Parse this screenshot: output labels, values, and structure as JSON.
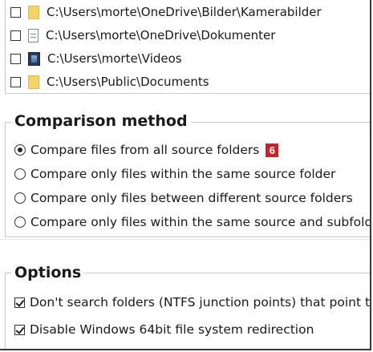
{
  "folders": [
    {
      "path": "C:\\Users\\morte\\OneDrive\\Bilder\\Kamerabilder",
      "checked": false,
      "icon": "folder-icon"
    },
    {
      "path": "C:\\Users\\morte\\OneDrive\\Dokumenter",
      "checked": false,
      "icon": "documents-icon"
    },
    {
      "path": "C:\\Users\\morte\\Videos",
      "checked": false,
      "icon": "videos-icon"
    },
    {
      "path": "C:\\Users\\Public\\Documents",
      "checked": false,
      "icon": "folder-icon"
    }
  ],
  "comparison": {
    "title": "Comparison method",
    "options": [
      {
        "label": "Compare files from all source folders",
        "selected": true
      },
      {
        "label": "Compare only files within the same source folder",
        "selected": false
      },
      {
        "label": "Compare only files between different source folders",
        "selected": false
      },
      {
        "label": "Compare only files within the same source and subfolders",
        "selected": false
      }
    ],
    "badge": "6",
    "badge_color": "#c6242b"
  },
  "options": {
    "title": "Options",
    "items": [
      {
        "label": "Don't search folders (NTFS junction points) that point to the same folder",
        "checked": true
      },
      {
        "label": "Disable Windows 64bit file system redirection",
        "checked": true
      }
    ]
  }
}
